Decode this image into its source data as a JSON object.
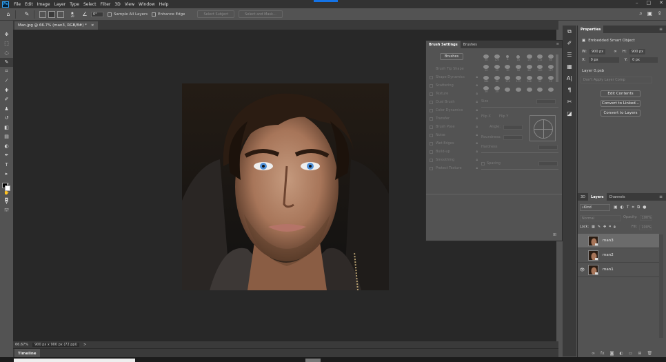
{
  "app": {
    "logo": "Ps"
  },
  "menu": [
    "File",
    "Edit",
    "Image",
    "Layer",
    "Type",
    "Select",
    "Filter",
    "3D",
    "View",
    "Window",
    "Help"
  ],
  "window_controls": [
    "–",
    "□",
    "✕"
  ],
  "options_bar": {
    "brush_size": "20",
    "angle": "0°",
    "sample_all_layers": "Sample All Layers",
    "enhance_edge": "Enhance Edge",
    "select_subject": "Select Subject",
    "select_and_mask": "Select and Mask..."
  },
  "document": {
    "tab_title": "Man.jpg @ 66.7% (man3, RGB/8#) *",
    "close": "×"
  },
  "status": {
    "zoom": "66.67%",
    "dimensions": "900 px x 900 px (72 ppi)",
    "arrow": ">"
  },
  "timeline": {
    "label": "Timeline"
  },
  "brush_settings": {
    "tabs": [
      "Brush Settings",
      "Brushes"
    ],
    "brushes_button": "Brushes",
    "options": [
      "Brush Tip Shape",
      "Shape Dynamics",
      "Scattering",
      "Texture",
      "Dual Brush",
      "Color Dynamics",
      "Transfer",
      "Brush Pose",
      "Noise",
      "Wet Edges",
      "Build-up",
      "Smoothing",
      "Protect Texture"
    ],
    "tip_sizes": [
      "30",
      "123",
      "8",
      "10",
      "25",
      "112",
      "60",
      "50",
      "25",
      "30",
      "50",
      "60",
      "100",
      "127",
      "284",
      "80",
      "174",
      "175",
      "306",
      "50",
      "25",
      "36",
      "25",
      "",
      "",
      "",
      "",
      ""
    ],
    "size_label": "Size",
    "flip_x": "Flip X",
    "flip_y": "Flip Y",
    "angle_label": "Angle:",
    "roundness_label": "Roundness:",
    "hardness_label": "Hardness",
    "spacing_label": "Spacing"
  },
  "properties": {
    "title": "Properties",
    "type": "Embedded Smart Object",
    "w_label": "W:",
    "w_value": "900 px",
    "h_label": "H:",
    "h_value": "900 px",
    "x_label": "X:",
    "x_value": "0 px",
    "y_label": "Y:",
    "y_value": "0 px",
    "source": "Layer 0.psb",
    "comp_select": "Don't Apply Layer Comp",
    "edit_contents": "Edit Contents",
    "convert_linked": "Convert to Linked...",
    "convert_layers": "Convert to Layers"
  },
  "layers_panel": {
    "tabs": [
      "3D",
      "Layers",
      "Channels"
    ],
    "kind": "Kind",
    "blend_mode": "Normal",
    "opacity_label": "Opacity:",
    "opacity_value": "100%",
    "lock_label": "Lock:",
    "fill_label": "Fill:",
    "fill_value": "100%",
    "layers": [
      {
        "name": "man3",
        "visible": false,
        "selected": true
      },
      {
        "name": "man2",
        "visible": false,
        "selected": false
      },
      {
        "name": "man1",
        "visible": true,
        "selected": false
      }
    ]
  },
  "colors": {
    "accent": "#1473e6",
    "panel": "#535353",
    "dark": "#323232",
    "canvas": "#282828"
  }
}
